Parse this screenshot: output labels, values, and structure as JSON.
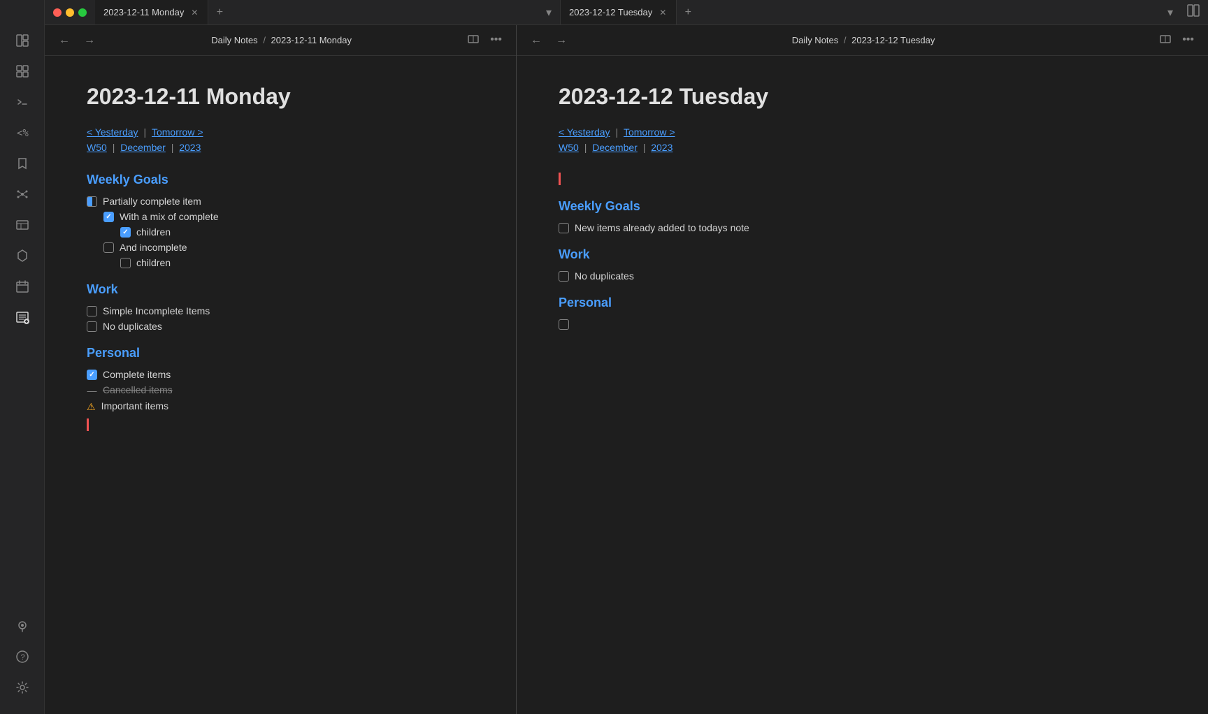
{
  "window": {
    "traffic_red": "●",
    "traffic_yellow": "●",
    "traffic_green": "●"
  },
  "left_tab": {
    "title": "2023-12-11 Monday",
    "close": "✕",
    "add": "+",
    "dropdown": "▾"
  },
  "right_tab": {
    "title": "2023-12-12 Tuesday",
    "close": "✕",
    "add": "+",
    "dropdown": "▾"
  },
  "left_pane": {
    "back": "←",
    "forward": "→",
    "breadcrumb_part1": "Daily Notes",
    "breadcrumb_sep": "/",
    "breadcrumb_part2": "2023-12-11 Monday",
    "title": "2023-12-11 Monday",
    "nav_yesterday": "< Yesterday",
    "nav_sep1": "|",
    "nav_tomorrow": "Tomorrow >",
    "nav_sep2": "|",
    "nav_w50": "W50",
    "nav_sep3": "|",
    "nav_december": "December",
    "nav_sep4": "|",
    "nav_2023": "2023",
    "section1": "Weekly Goals",
    "item1_text": "Partially complete item",
    "item1_1_text": "With a mix of complete",
    "item1_1_1_text": "children",
    "item1_2_text": "And incomplete",
    "item1_2_1_text": "children",
    "section2": "Work",
    "item2_1_text": "Simple Incomplete Items",
    "item2_2_text": "No duplicates",
    "section3": "Personal",
    "item3_1_text": "Complete items",
    "item3_2_text": "Cancelled items",
    "item3_3_text": "Important items"
  },
  "right_pane": {
    "back": "←",
    "forward": "→",
    "breadcrumb_part1": "Daily Notes",
    "breadcrumb_sep": "/",
    "breadcrumb_part2": "2023-12-12 Tuesday",
    "title": "2023-12-12 Tuesday",
    "nav_yesterday": "< Yesterday",
    "nav_sep1": "|",
    "nav_tomorrow": "Tomorrow >",
    "nav_sep2": "|",
    "nav_w50": "W50",
    "nav_sep3": "|",
    "nav_december": "December",
    "nav_sep4": "|",
    "nav_2023": "2023",
    "section1": "Weekly Goals",
    "item1_1_text": "New items already added to todays note",
    "section2": "Work",
    "item2_1_text": "No duplicates",
    "section3": "Personal"
  },
  "sidebar": {
    "icons": [
      {
        "name": "layout-icon",
        "glyph": "⊞"
      },
      {
        "name": "dashboard-icon",
        "glyph": "▦"
      },
      {
        "name": "terminal-icon",
        "glyph": ">_"
      },
      {
        "name": "percent-icon",
        "glyph": "<%"
      },
      {
        "name": "bookmark-icon",
        "glyph": "🔖"
      },
      {
        "name": "graph-icon",
        "glyph": "⬡"
      },
      {
        "name": "table-icon",
        "glyph": "⊟"
      },
      {
        "name": "plugin-icon",
        "glyph": "✈"
      },
      {
        "name": "calendar-icon",
        "glyph": "📅"
      },
      {
        "name": "list-icon",
        "glyph": "≡"
      }
    ],
    "bottom_icons": [
      {
        "name": "pin-icon",
        "glyph": "📌"
      },
      {
        "name": "help-icon",
        "glyph": "?"
      },
      {
        "name": "settings-icon",
        "glyph": "⚙"
      }
    ]
  }
}
